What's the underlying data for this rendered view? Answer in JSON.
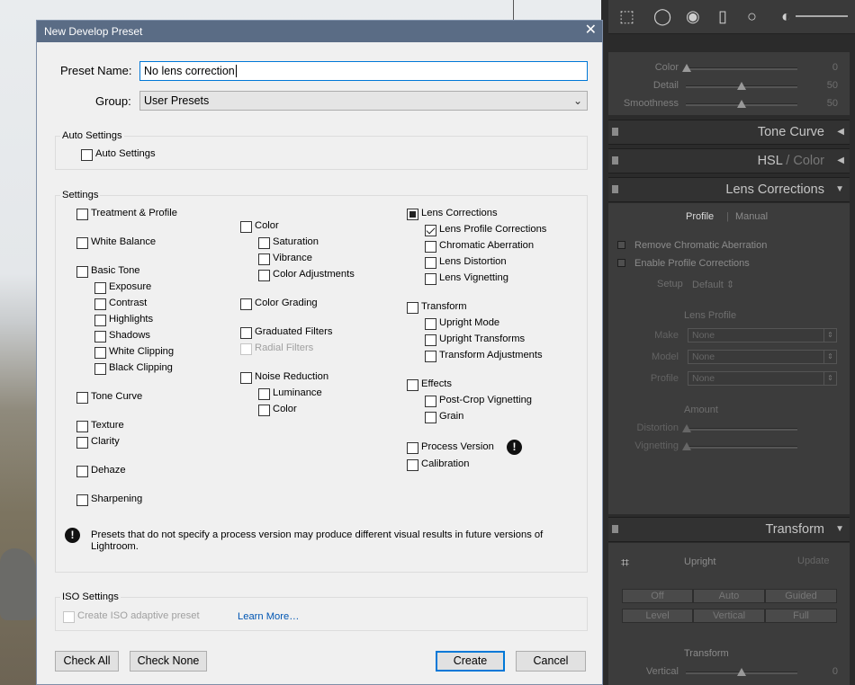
{
  "dialog": {
    "title": "New Develop Preset",
    "preset_name_label": "Preset Name:",
    "preset_name_value": "No lens correction",
    "group_label": "Group:",
    "group_value": "User Presets",
    "auto_settings_title": "Auto Settings",
    "auto_settings_checkbox": "Auto Settings",
    "settings_title": "Settings",
    "col1": {
      "treatment": "Treatment & Profile",
      "white_balance": "White Balance",
      "basic_tone": "Basic Tone",
      "exposure": "Exposure",
      "contrast": "Contrast",
      "highlights": "Highlights",
      "shadows": "Shadows",
      "white_clipping": "White Clipping",
      "black_clipping": "Black Clipping",
      "tone_curve": "Tone Curve",
      "texture": "Texture",
      "clarity": "Clarity",
      "dehaze": "Dehaze",
      "sharpening": "Sharpening"
    },
    "col2": {
      "color": "Color",
      "saturation": "Saturation",
      "vibrance": "Vibrance",
      "color_adjustments": "Color Adjustments",
      "color_grading": "Color Grading",
      "graduated_filters": "Graduated Filters",
      "radial_filters": "Radial Filters",
      "noise_reduction": "Noise Reduction",
      "luminance": "Luminance",
      "nr_color": "Color"
    },
    "col3": {
      "lens_corrections": "Lens Corrections",
      "lens_profile_corrections": "Lens Profile Corrections",
      "chromatic_aberration": "Chromatic Aberration",
      "lens_distortion": "Lens Distortion",
      "lens_vignetting": "Lens Vignetting",
      "transform": "Transform",
      "upright_mode": "Upright Mode",
      "upright_transforms": "Upright Transforms",
      "transform_adjustments": "Transform Adjustments",
      "effects": "Effects",
      "post_crop_vignetting": "Post-Crop Vignetting",
      "grain": "Grain",
      "process_version": "Process Version",
      "calibration": "Calibration"
    },
    "warning_text": "Presets that do not specify a process version may produce different visual results in future versions of Lightroom.",
    "iso_title": "ISO Settings",
    "iso_checkbox": "Create ISO adaptive preset",
    "learn_more": "Learn More…",
    "check_all": "Check All",
    "check_none": "Check None",
    "create": "Create",
    "cancel": "Cancel"
  },
  "panel": {
    "color_label": "Color",
    "color_value": "0",
    "detail_label": "Detail",
    "detail_value": "50",
    "smoothness_label": "Smoothness",
    "smoothness_value": "50",
    "tone_curve": "Tone Curve",
    "hsl": "HSL",
    "hsl_sep": "/",
    "hsl_color": "Color",
    "lens_corrections": "Lens Corrections",
    "tab_profile": "Profile",
    "tab_manual": "Manual",
    "remove_ca": "Remove Chromatic Aberration",
    "enable_profile": "Enable Profile Corrections",
    "setup_label": "Setup",
    "setup_value": "Default",
    "lens_profile_title": "Lens Profile",
    "make_label": "Make",
    "model_label": "Model",
    "profile_label": "Profile",
    "none": "None",
    "amount_title": "Amount",
    "distortion_label": "Distortion",
    "vignetting_label": "Vignetting",
    "transform": "Transform",
    "upright_label": "Upright",
    "update": "Update",
    "seg": [
      "Off",
      "Auto",
      "Guided",
      "Level",
      "Vertical",
      "Full"
    ],
    "transform_sub": "Transform",
    "vertical_label": "Vertical",
    "vertical_value": "0"
  }
}
